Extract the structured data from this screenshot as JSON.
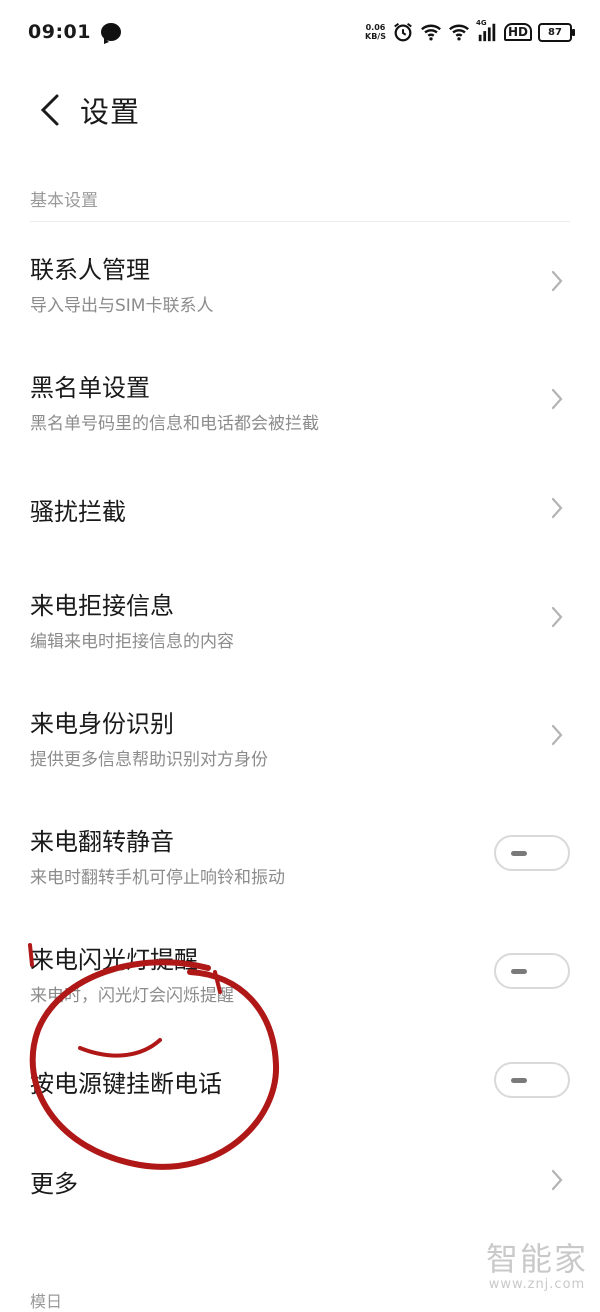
{
  "status_bar": {
    "time": "09:01",
    "net_speed_value": "0.06",
    "net_speed_unit": "KB/S",
    "network_badge": "4G",
    "hd_badge": "HD",
    "battery": "87"
  },
  "header": {
    "title": "设置"
  },
  "section": {
    "label": "基本设置"
  },
  "items": [
    {
      "title": "联系人管理",
      "subtitle": "导入导出与SIM卡联系人",
      "control": "chevron"
    },
    {
      "title": "黑名单设置",
      "subtitle": "黑名单号码里的信息和电话都会被拦截",
      "control": "chevron"
    },
    {
      "title": "骚扰拦截",
      "subtitle": "",
      "control": "chevron"
    },
    {
      "title": "来电拒接信息",
      "subtitle": "编辑来电时拒接信息的内容",
      "control": "chevron"
    },
    {
      "title": "来电身份识别",
      "subtitle": "提供更多信息帮助识别对方身份",
      "control": "chevron"
    },
    {
      "title": "来电翻转静音",
      "subtitle": "来电时翻转手机可停止响铃和振动",
      "control": "toggle",
      "on": false
    },
    {
      "title": "来电闪光灯提醒",
      "subtitle": "来电时，闪光灯会闪烁提醒",
      "control": "toggle",
      "on": false
    },
    {
      "title": "按电源键挂断电话",
      "subtitle": "",
      "control": "toggle",
      "on": false
    },
    {
      "title": "更多",
      "subtitle": "",
      "control": "chevron"
    }
  ],
  "partial_footer_label": "模日",
  "watermark": {
    "name": "智能家",
    "url": "www.znj.com"
  },
  "colors": {
    "annotation": "#b01818",
    "divider": "#ececec",
    "subtitle": "#8c8c8c",
    "toggle_border": "#d9d9d9"
  }
}
